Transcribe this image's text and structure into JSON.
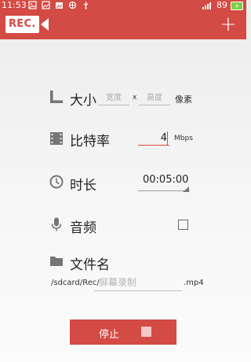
{
  "status_bar": {
    "time": "11:53",
    "battery_level": "89",
    "battery_icon_text": "+"
  },
  "app_bar": {
    "logo_text": "REC.",
    "add_icon": "+"
  },
  "size_row": {
    "label": "大小",
    "width_placeholder": "宽度",
    "separator": "x",
    "height_placeholder": "高度",
    "unit": "像素"
  },
  "bitrate_row": {
    "label": "比特率",
    "value": "4",
    "unit": "Mbps"
  },
  "duration_row": {
    "label": "时长",
    "value": "00:05:00"
  },
  "audio_row": {
    "label": "音频",
    "checked": false
  },
  "filename_row": {
    "label": "文件名",
    "path_prefix": "/sdcard/Rec/",
    "placeholder": "屏幕录制",
    "extension": ".mp4"
  },
  "stop_button": {
    "label": "停止"
  },
  "colors": {
    "accent": "#d44a44",
    "icon_gray": "#757575"
  }
}
